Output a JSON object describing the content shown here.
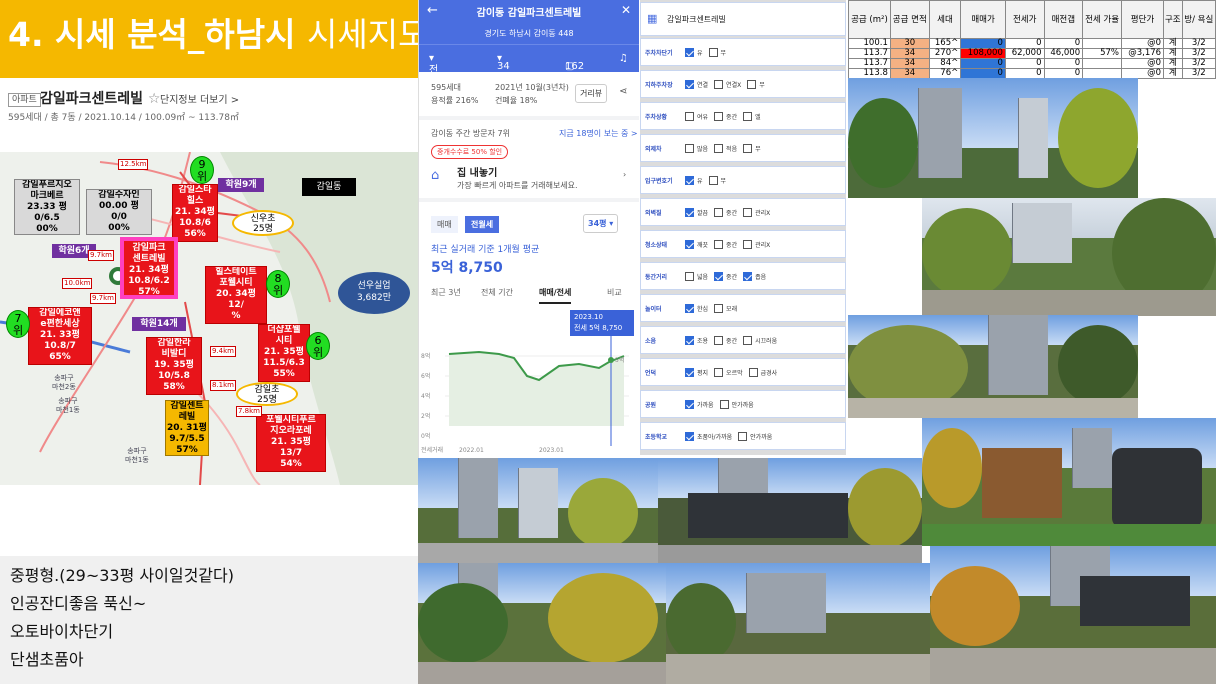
{
  "banner": {
    "num": "4. 시세 분석_하남시 ",
    "rest": "시세지도"
  },
  "apt": {
    "badge": "아파트",
    "name": "감일파크센트레빌",
    "star": "☆",
    "more": "단지정보 더보기 >",
    "sub": "595세대 / 총 7동 / 2021.10.14 / 100.09㎡ ~ 113.78㎡"
  },
  "map": {
    "boxes": [
      {
        "id": "gray1",
        "lines": [
          "감일푸르지오",
          "마크베르",
          "23.33 평",
          "0/6.5",
          "00%"
        ]
      },
      {
        "id": "gray2",
        "lines": [
          "감일수자인",
          "00.00 평",
          "0/0",
          "00%"
        ]
      },
      {
        "id": "red-hills",
        "lines": [
          "감일스타",
          "힐스",
          "21. 34평",
          "10.8/6",
          "56%"
        ]
      },
      {
        "id": "red-main",
        "lines": [
          "감일파크",
          "센트레빌",
          "21. 34평",
          "10.8/6.2",
          "57%"
        ]
      },
      {
        "id": "red-hillstate",
        "lines": [
          "힐스테이트",
          "포웰시티",
          "20. 34평",
          "12/",
          "%"
        ]
      },
      {
        "id": "red-ecopark",
        "lines": [
          "감일에코앤",
          "e편한세상",
          "21. 33평",
          "10.8/7",
          "65%"
        ]
      },
      {
        "id": "red-hanra",
        "lines": [
          "감일한라",
          "비발디",
          "19. 35평",
          "10/5.8",
          "58%"
        ]
      },
      {
        "id": "red-thesharp",
        "lines": [
          "더샵포웰",
          "시티",
          "21. 35평",
          "11.5/6.3",
          "55%"
        ]
      },
      {
        "id": "yellow-central",
        "lines": [
          "감일센트",
          "레빌",
          "20. 31평",
          "9.7/5.5",
          "57%"
        ]
      },
      {
        "id": "red-powell",
        "lines": [
          "포웰시티푸르",
          "지오라포레",
          "21. 35평",
          "13/7",
          "54%"
        ]
      }
    ],
    "academies": [
      "학원9개",
      "학원6개",
      "학원14개"
    ],
    "district": "감일동",
    "schools": [
      {
        "name": "신우초",
        "count": "25명"
      },
      {
        "name": "감일초",
        "count": "25명"
      }
    ],
    "company": {
      "name": "선우실업",
      "value": "3,682만"
    },
    "ranks": [
      {
        "num": "9",
        "label": "위"
      },
      {
        "num": "8",
        "label": "위"
      },
      {
        "num": "7",
        "label": "위"
      },
      {
        "num": "6",
        "label": "위"
      }
    ],
    "distances": [
      "12.5km",
      "9.7km",
      "10.0km",
      "9.7km",
      "9.4km",
      "8.1km",
      "7.8km"
    ],
    "areas": [
      [
        "송파구",
        "마천2동"
      ],
      [
        "송파구",
        "마천1동"
      ],
      [
        "송파구",
        "마천1동"
      ]
    ]
  },
  "notes": [
    "중평형.(29~33평 사이일것같다)",
    "인공잔디좋음 푹신~",
    "오토바이차단기",
    "단샘초품아"
  ],
  "app": {
    "title": "감이동 감일파크센트레빌",
    "address": "경기도 하남시 감이동 448",
    "tab_type": "전월세",
    "tab_size": "34평",
    "tab_comments": "162",
    "units": "595세대",
    "ratio": "용적률 216%",
    "built": "2021년 10월(3년차)",
    "cover": "건폐율 18%",
    "distance_btn": "거리뷰",
    "visitors": "감이동 주간 방문자 7위",
    "viewers": "지금 18명이 보는 중 >",
    "discount": "중개수수료 50% 할인",
    "sell_title": "집 내놓기",
    "sell_sub": "가장 빠르게 아파트를 거래해보세요.",
    "seg_sale": "매매",
    "seg_rent": "전월세",
    "size_select": "34평 ▾",
    "recent_label": "최근 실거래 기준 1개월 평균",
    "recent_value": "5억 8,750",
    "chart_tabs": [
      "최근 3년",
      "전체 기간",
      "매매/전세",
      "비교"
    ],
    "tooltip_date": "2023.10",
    "tooltip_value": "전세 5억 8,750",
    "y_ticks": [
      "8억",
      "6억",
      "4억",
      "2억",
      "0억"
    ],
    "x_ticks": [
      "2022.01",
      "2023.01"
    ],
    "legend": "전세거래",
    "end_label": "5억"
  },
  "filter": {
    "search": "감일파크센트레빌",
    "rows": [
      {
        "label": "주차차단기",
        "opts": [
          {
            "t": "유",
            "on": true
          },
          {
            "t": "무",
            "on": false
          }
        ]
      },
      {
        "label": "지하주차장",
        "opts": [
          {
            "t": "연결",
            "on": true
          },
          {
            "t": "연결X",
            "on": false
          },
          {
            "t": "무",
            "on": false
          }
        ]
      },
      {
        "label": "주차상황",
        "opts": [
          {
            "t": "여유",
            "on": false
          },
          {
            "t": "중간",
            "on": false
          },
          {
            "t": "엘",
            "on": false
          }
        ]
      },
      {
        "label": "외제차",
        "opts": [
          {
            "t": "많음",
            "on": false
          },
          {
            "t": "적음",
            "on": false
          },
          {
            "t": "무",
            "on": false
          }
        ]
      },
      {
        "label": "입구변호기",
        "opts": [
          {
            "t": "유",
            "on": true
          },
          {
            "t": "무",
            "on": false
          }
        ]
      },
      {
        "label": "외벽질",
        "opts": [
          {
            "t": "깔끔",
            "on": true
          },
          {
            "t": "중간",
            "on": false
          },
          {
            "t": "관리X",
            "on": false
          }
        ]
      },
      {
        "label": "청소상태",
        "opts": [
          {
            "t": "깨끗",
            "on": true
          },
          {
            "t": "중간",
            "on": false
          },
          {
            "t": "관리X",
            "on": false
          }
        ]
      },
      {
        "label": "동간거리",
        "opts": [
          {
            "t": "넓음",
            "on": false
          },
          {
            "t": "중간",
            "on": true
          },
          {
            "t": "좁음",
            "on": true
          }
        ]
      },
      {
        "label": "놀이터",
        "opts": [
          {
            "t": "한심",
            "on": true
          },
          {
            "t": "모래",
            "on": false
          }
        ]
      },
      {
        "label": "소음",
        "opts": [
          {
            "t": "조용",
            "on": true
          },
          {
            "t": "중간",
            "on": false
          },
          {
            "t": "시끄러움",
            "on": false
          }
        ]
      },
      {
        "label": "언덕",
        "opts": [
          {
            "t": "평지",
            "on": true
          },
          {
            "t": "오르막",
            "on": false
          },
          {
            "t": "급경사",
            "on": false
          }
        ]
      },
      {
        "label": "공원",
        "opts": [
          {
            "t": "가까움",
            "on": true
          },
          {
            "t": "안가까움",
            "on": false
          }
        ]
      },
      {
        "label": "초등학교",
        "opts": [
          {
            "t": "초품아/가까움",
            "on": true
          },
          {
            "t": "안가까움",
            "on": false
          }
        ]
      }
    ]
  },
  "table": {
    "headers": [
      "공급 (m²)",
      "공급 면적",
      "세대",
      "매매가",
      "전세가",
      "매전갭",
      "전세 가율",
      "평단가",
      "구조",
      "방/ 욕실"
    ],
    "rows": [
      [
        "100.1",
        "30",
        "165^",
        "0",
        "0",
        "0",
        "",
        "@0",
        "계",
        "3/2"
      ],
      [
        "113.7",
        "34",
        "270^",
        "108,000",
        "62,000",
        "46,000",
        "57%",
        "@3,176",
        "계",
        "3/2"
      ],
      [
        "113.7",
        "34",
        "84^",
        "0",
        "0",
        "0",
        "",
        "@0",
        "계",
        "3/2"
      ],
      [
        "113.8",
        "34",
        "76^",
        "0",
        "0",
        "0",
        "",
        "@0",
        "계",
        "3/2"
      ]
    ]
  },
  "colors": {
    "banner": "#f5b800",
    "app_blue": "#4a6ee0",
    "red_box": "#e8141a",
    "rank_green": "#22dd22",
    "purple": "#7030a0",
    "area_orange": "#f4b183",
    "price_red": "#ff0000",
    "price_blue": "#2f75d6"
  }
}
